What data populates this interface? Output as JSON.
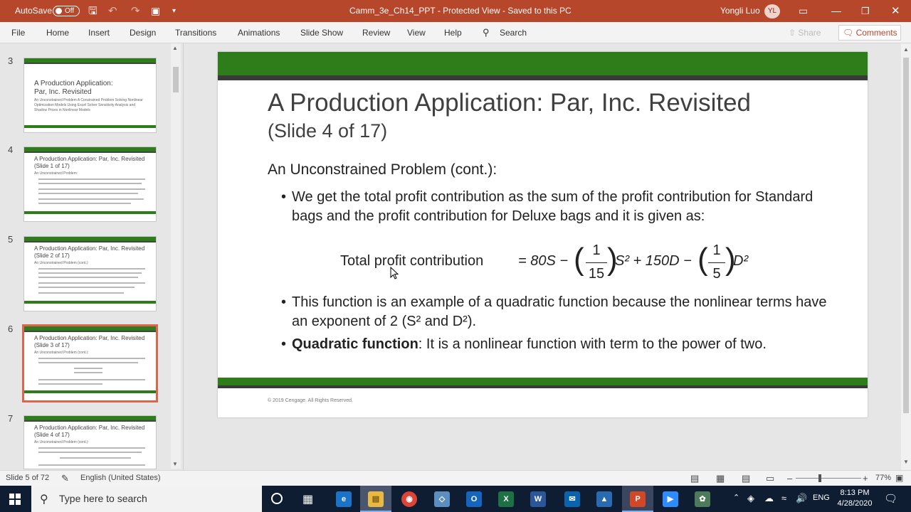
{
  "titlebar": {
    "autosave_label": "AutoSave",
    "autosave_state": "Off",
    "doc_title": "Camm_3e_Ch14_PPT  -  Protected View  -  Saved to this PC",
    "user_name": "Yongli Luo",
    "user_initials": "YL"
  },
  "ribbon": {
    "tabs": [
      "File",
      "Home",
      "Insert",
      "Design",
      "Transitions",
      "Animations",
      "Slide Show",
      "Review",
      "View",
      "Help"
    ],
    "search_label": "Search",
    "share_label": "Share",
    "comments_label": "Comments"
  },
  "thumbnails": [
    {
      "num": "3",
      "title": "A Production Application: Par, Inc. Revisited",
      "sub": "An Unconstrained Problem\nA Constrained Problem\nSolving Nonlinear Optimization Models Using Excel Solver\nSensitivity Analysis and Shadow Prices in Nonlinear Models"
    },
    {
      "num": "4",
      "title": "A Production Application: Par, Inc. Revisited (Slide 1 of 17)",
      "sub": "An Unconstrained Problem:"
    },
    {
      "num": "5",
      "title": "A Production Application: Par, Inc. Revisited (Slide 2 of 17)",
      "sub": "An Unconstrained Problem (cont.):"
    },
    {
      "num": "6",
      "title": "A Production Application: Par, Inc. Revisited (Slide 3 of 17)",
      "sub": "An Unconstrained Problem (cont.):"
    },
    {
      "num": "7",
      "title": "A Production Application: Par, Inc. Revisited (Slide 4 of 17)",
      "sub": "An Unconstrained Problem (cont.):"
    }
  ],
  "slide": {
    "title": "A Production Application: Par, Inc. Revisited",
    "subtitle": "(Slide 4 of 17)",
    "heading": "An Unconstrained Problem (cont.):",
    "bullet1": "We get the total profit contribution as the sum of the profit contribution for Standard bags and the profit contribution for Deluxe bags and it is given as:",
    "formula": {
      "lhs": "Total profit contribution",
      "eq": "= 80S −",
      "frac1_num": "1",
      "frac1_den": "15",
      "mid": "S² + 150D −",
      "frac2_num": "1",
      "frac2_den": "5",
      "end": "D²"
    },
    "bullet2": "This function is an example of a quadratic function because the nonlinear terms have an exponent of  2 (S²  and D²).",
    "bullet3_bold": "Quadratic function",
    "bullet3_rest": ": It is a nonlinear function with term to the power of two.",
    "copyright": "© 2019 Cengage. All Rights Reserved."
  },
  "statusbar": {
    "slide_info": "Slide 5 of 72",
    "language": "English (United States)",
    "zoom": "77%"
  },
  "taskbar": {
    "search_placeholder": "Type here to search",
    "time": "8:13 PM",
    "date": "4/28/2020",
    "lang": "ENG"
  }
}
